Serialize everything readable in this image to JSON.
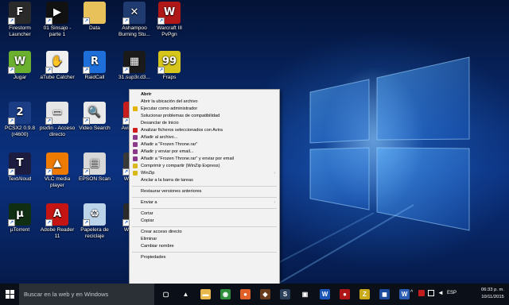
{
  "desktop": {
    "icons": [
      {
        "label": "Firestorm Launcher",
        "icon": "firestorm-icon",
        "color": "#2a2a2a",
        "glyph": "F"
      },
      {
        "label": "01 Sinsajo - parte 1",
        "icon": "video-file-icon",
        "color": "#111111",
        "glyph": "▶"
      },
      {
        "label": "Data",
        "icon": "folder-icon",
        "color": "#e8c15a",
        "glyph": ""
      },
      {
        "label": "Ashampoo Burning Stu...",
        "icon": "ashampoo-icon",
        "color": "#1f3b70",
        "glyph": "✕"
      },
      {
        "label": "Warcraft III PvPgn",
        "icon": "warcraft-icon",
        "color": "#b01818",
        "glyph": "W"
      },
      {
        "label": "Jugar",
        "icon": "wii-games-icon",
        "color": "#6cb030",
        "glyph": "W"
      },
      {
        "label": "aTube Catcher",
        "icon": "atube-catcher-icon",
        "color": "#f0f0f0",
        "glyph": "✋"
      },
      {
        "label": "RaidCall",
        "icon": "raidcall-icon",
        "color": "#1e6fd9",
        "glyph": "R"
      },
      {
        "label": "31.sup3r.d3...",
        "icon": "film-file-icon",
        "color": "#1a1a1a",
        "glyph": "▦"
      },
      {
        "label": "Fraps",
        "icon": "fraps-icon",
        "color": "#d6c51a",
        "glyph": "99"
      },
      {
        "label": "PCSX2 0.9.8 (r4600)",
        "icon": "pcsx2-icon",
        "color": "#1b3d86",
        "glyph": "2"
      },
      {
        "label": "psxfin - Acceso directo",
        "icon": "psxfin-icon",
        "color": "#e6e6e6",
        "glyph": "▭"
      },
      {
        "label": "Video Search",
        "icon": "video-search-icon",
        "color": "#eaeaea",
        "glyph": "🔍"
      },
      {
        "label": "Avira Avir...",
        "icon": "avira-icon",
        "color": "#c81e1e",
        "glyph": "A"
      },
      {
        "label": "TextAloud",
        "icon": "textaloud-icon",
        "color": "#1c1c40",
        "glyph": "T"
      },
      {
        "label": "VLC media player",
        "icon": "vlc-icon",
        "color": "#ee7a00",
        "glyph": "▲"
      },
      {
        "label": "EPSON Scan",
        "icon": "epson-scan-icon",
        "color": "#d8d8d8",
        "glyph": "▤"
      },
      {
        "label": "Warcra...",
        "icon": "warcraft-icon",
        "color": "#3a3a3a",
        "glyph": "W"
      },
      {
        "label": "µTorrent",
        "icon": "utorrent-icon",
        "color": "#0f2e12",
        "glyph": "µ"
      },
      {
        "label": "Adobe Reader 11",
        "icon": "adobe-reader-icon",
        "color": "#c41414",
        "glyph": "A"
      },
      {
        "label": "Papelera de reciclaje",
        "icon": "recycle-bin-icon",
        "color": "#bcd4ea",
        "glyph": "♻"
      },
      {
        "label": "Warc... II",
        "icon": "warcraft-icon",
        "color": "#2b2b2b",
        "glyph": "W"
      }
    ]
  },
  "context_menu": {
    "items": [
      {
        "type": "item",
        "label": "Abrir",
        "bold": true,
        "name": "menu-item-abrir"
      },
      {
        "type": "item",
        "label": "Abrir la ubicación del archivo",
        "name": "menu-item-open-location"
      },
      {
        "type": "item",
        "label": "Ejecutar como administrador",
        "icon": "shield-icon",
        "iconColor": "#e6b400",
        "name": "menu-item-run-as-admin"
      },
      {
        "type": "item",
        "label": "Solucionar problemas de compatibilidad",
        "name": "menu-item-troubleshoot"
      },
      {
        "type": "item",
        "label": "Desanclar de Inicio",
        "name": "menu-item-unpin-start"
      },
      {
        "type": "item",
        "label": "Analizar ficheros seleccionados con Avira",
        "icon": "avira-icon",
        "iconColor": "#d11c1c",
        "name": "menu-item-avira-scan"
      },
      {
        "type": "item",
        "label": "Añadir al archivo...",
        "icon": "winrar-icon",
        "iconColor": "#8b3a8b",
        "name": "menu-item-add-archive"
      },
      {
        "type": "item",
        "label": "Añadir a \"Frozen Throne.rar\"",
        "icon": "winrar-icon",
        "iconColor": "#8b3a8b",
        "name": "menu-item-add-rar"
      },
      {
        "type": "item",
        "label": "Añadir y enviar por email...",
        "icon": "winrar-icon",
        "iconColor": "#8b3a8b",
        "name": "menu-item-add-email"
      },
      {
        "type": "item",
        "label": "Añadir a \"Frozen Throne.rar\" y enviar por email",
        "icon": "winrar-icon",
        "iconColor": "#8b3a8b",
        "name": "menu-item-add-rar-email"
      },
      {
        "type": "item",
        "label": "Comprimir y compartir (WinZip Express)",
        "icon": "winzip-icon",
        "iconColor": "#d8b81a",
        "name": "menu-item-winzip-express"
      },
      {
        "type": "item",
        "label": "WinZip",
        "icon": "winzip-icon",
        "iconColor": "#d8b81a",
        "arrow": true,
        "name": "menu-item-winzip"
      },
      {
        "type": "item",
        "label": "Anclar a la barra de tareas",
        "name": "menu-item-pin-taskbar"
      },
      {
        "type": "sep"
      },
      {
        "type": "item",
        "label": "Restaurar versiones anteriores",
        "name": "menu-item-restore-versions"
      },
      {
        "type": "sep"
      },
      {
        "type": "item",
        "label": "Enviar a",
        "arrow": true,
        "name": "menu-item-send-to"
      },
      {
        "type": "sep"
      },
      {
        "type": "item",
        "label": "Cortar",
        "name": "menu-item-cut"
      },
      {
        "type": "item",
        "label": "Copiar",
        "name": "menu-item-copy"
      },
      {
        "type": "sep"
      },
      {
        "type": "item",
        "label": "Crear acceso directo",
        "name": "menu-item-create-shortcut"
      },
      {
        "type": "item",
        "label": "Eliminar",
        "name": "menu-item-delete"
      },
      {
        "type": "item",
        "label": "Cambiar nombre",
        "name": "menu-item-rename"
      },
      {
        "type": "sep"
      },
      {
        "type": "item",
        "label": "Propiedades",
        "name": "menu-item-properties"
      }
    ]
  },
  "taskbar": {
    "search_placeholder": "Buscar en la web y en Windows",
    "apps": [
      {
        "icon": "task-view-icon",
        "color": "#0b0f17",
        "glyph": "▢",
        "name": "taskbar-task-view"
      },
      {
        "icon": "game-icon",
        "color": "#0b0f17",
        "glyph": "▲",
        "name": "taskbar-app-1"
      },
      {
        "icon": "file-explorer-icon",
        "color": "#e8b84a",
        "glyph": "▬",
        "name": "taskbar-file-explorer"
      },
      {
        "icon": "chrome-icon",
        "color": "#2f8e3c",
        "glyph": "◉",
        "name": "taskbar-chrome"
      },
      {
        "icon": "firefox-icon",
        "color": "#e0602a",
        "glyph": "●",
        "name": "taskbar-firefox"
      },
      {
        "icon": "app-icon",
        "color": "#6a3c1e",
        "glyph": "◆",
        "name": "taskbar-app-2"
      },
      {
        "icon": "steam-icon",
        "color": "#2a3f5a",
        "glyph": "S",
        "name": "taskbar-steam"
      },
      {
        "icon": "store-icon",
        "color": "#0b0f17",
        "glyph": "▣",
        "name": "taskbar-store"
      },
      {
        "icon": "word-icon",
        "color": "#1a56b8",
        "glyph": "W",
        "name": "taskbar-word"
      },
      {
        "icon": "app-icon",
        "color": "#b01818",
        "glyph": "●",
        "name": "taskbar-app-3"
      },
      {
        "icon": "winzip-icon",
        "color": "#c9a81a",
        "glyph": "Z",
        "name": "taskbar-app-4"
      },
      {
        "icon": "app-icon",
        "color": "#1c4a9c",
        "glyph": "◼",
        "name": "taskbar-app-5"
      },
      {
        "icon": "word-icon",
        "color": "#2a5cb4",
        "glyph": "W",
        "name": "taskbar-app-6"
      }
    ],
    "tray": {
      "language": "ESP",
      "time": "06:33 p. m.",
      "date": "10/11/2015"
    }
  }
}
